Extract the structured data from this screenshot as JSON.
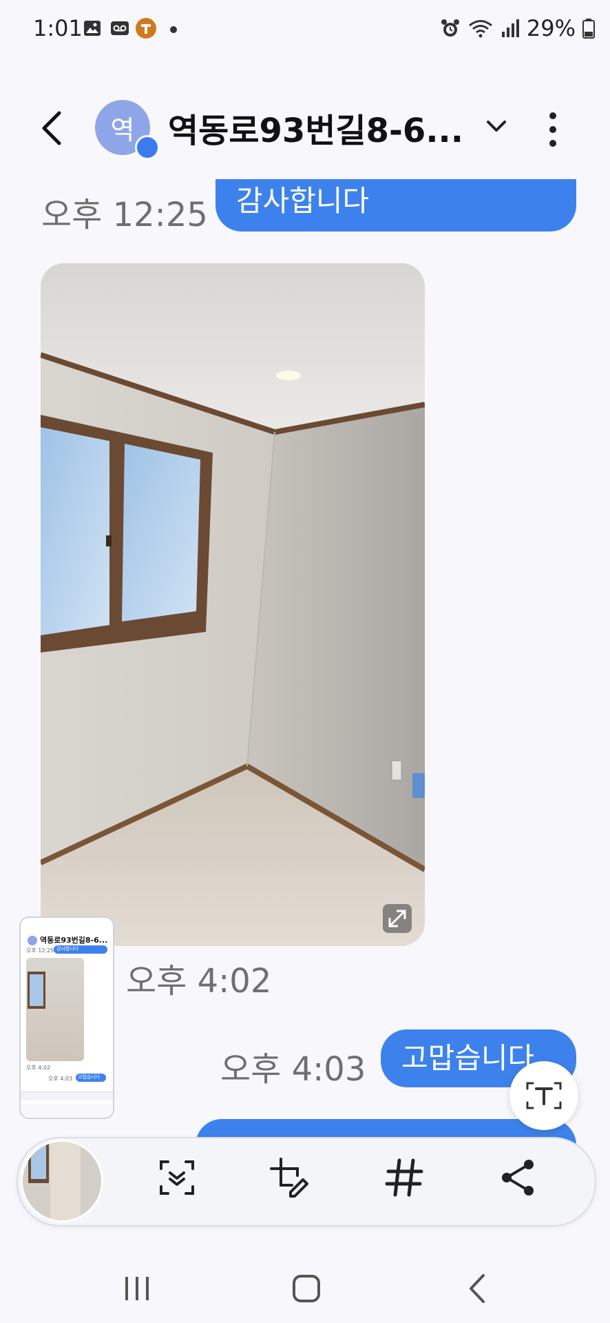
{
  "status_bar": {
    "time": "1:01",
    "battery": "29%",
    "left_icons": [
      "image-icon",
      "voicemail-icon",
      "t-app-icon",
      "dot-icon"
    ],
    "right_icons": [
      "alarm-icon",
      "wifi-icon",
      "signal-icon",
      "battery-icon"
    ]
  },
  "header": {
    "avatar_letter": "역",
    "title": "역동로93번길8-6..."
  },
  "messages": [
    {
      "time": "오후 12:25",
      "text": "감사합니다"
    },
    {
      "time": "오후 4:02",
      "type": "photo"
    },
    {
      "time": "오후 4:03",
      "text": "고맙습니다"
    }
  ],
  "thumbnail": {
    "title": "역동로93번길8-6...",
    "time1": "오후 12:25",
    "bubble1": "감사합니다",
    "time2": "오후 4:02",
    "time3": "오후 4:03",
    "bubble3": "고맙습니다"
  },
  "toolbar": {
    "items": [
      "scan-icon",
      "edit-crop-icon",
      "hashtag-icon",
      "share-icon"
    ]
  },
  "colors": {
    "accent": "#3d82ec",
    "background": "#f8f8fc"
  }
}
